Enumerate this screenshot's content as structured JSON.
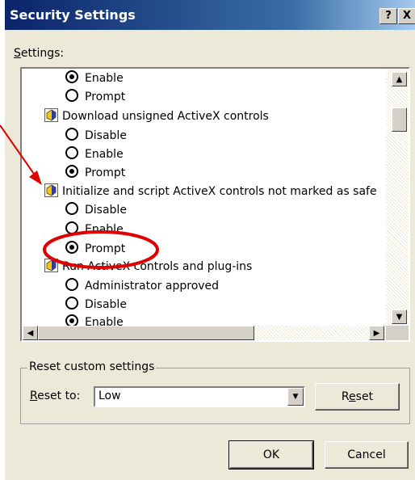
{
  "window": {
    "title": "Security Settings",
    "help_label": "?",
    "close_label": "X"
  },
  "settings_label": "Settings:",
  "settings_label_access_key": "S",
  "settings_label_rest": "ettings:",
  "list": [
    {
      "kind": "radio",
      "label": "Enable",
      "selected": true
    },
    {
      "kind": "radio",
      "label": "Prompt",
      "selected": false
    },
    {
      "kind": "setting",
      "label": "Download unsigned ActiveX controls",
      "icon": "setting-icon"
    },
    {
      "kind": "radio",
      "label": "Disable",
      "selected": false
    },
    {
      "kind": "radio",
      "label": "Enable",
      "selected": false
    },
    {
      "kind": "radio",
      "label": "Prompt",
      "selected": true
    },
    {
      "kind": "setting",
      "label": "Initialize and script ActiveX controls not marked as safe",
      "icon": "setting-icon"
    },
    {
      "kind": "radio",
      "label": "Disable",
      "selected": false
    },
    {
      "kind": "radio",
      "label": "Enable",
      "selected": false
    },
    {
      "kind": "radio",
      "label": "Prompt",
      "selected": true
    },
    {
      "kind": "setting",
      "label": "Run ActiveX controls and plug-ins",
      "icon": "setting-icon"
    },
    {
      "kind": "radio",
      "label": "Administrator approved",
      "selected": false
    },
    {
      "kind": "radio",
      "label": "Disable",
      "selected": false
    },
    {
      "kind": "radio",
      "label": "Enable",
      "selected": true
    }
  ],
  "reset_group": {
    "title": "Reset custom settings",
    "reset_to_key": "R",
    "reset_to_rest": "eset to:",
    "reset_to_label": "Reset to:",
    "value": "Low",
    "reset_button_pre": "R",
    "reset_button_key": "e",
    "reset_button_post": "set",
    "reset_button": "Reset"
  },
  "buttons": {
    "ok": "OK",
    "cancel": "Cancel"
  },
  "colors": {
    "annotation": "#e00000",
    "titlebar_start": "#0a246a",
    "titlebar_end": "#a6caf0",
    "dialog_bg": "#ece9d8"
  }
}
